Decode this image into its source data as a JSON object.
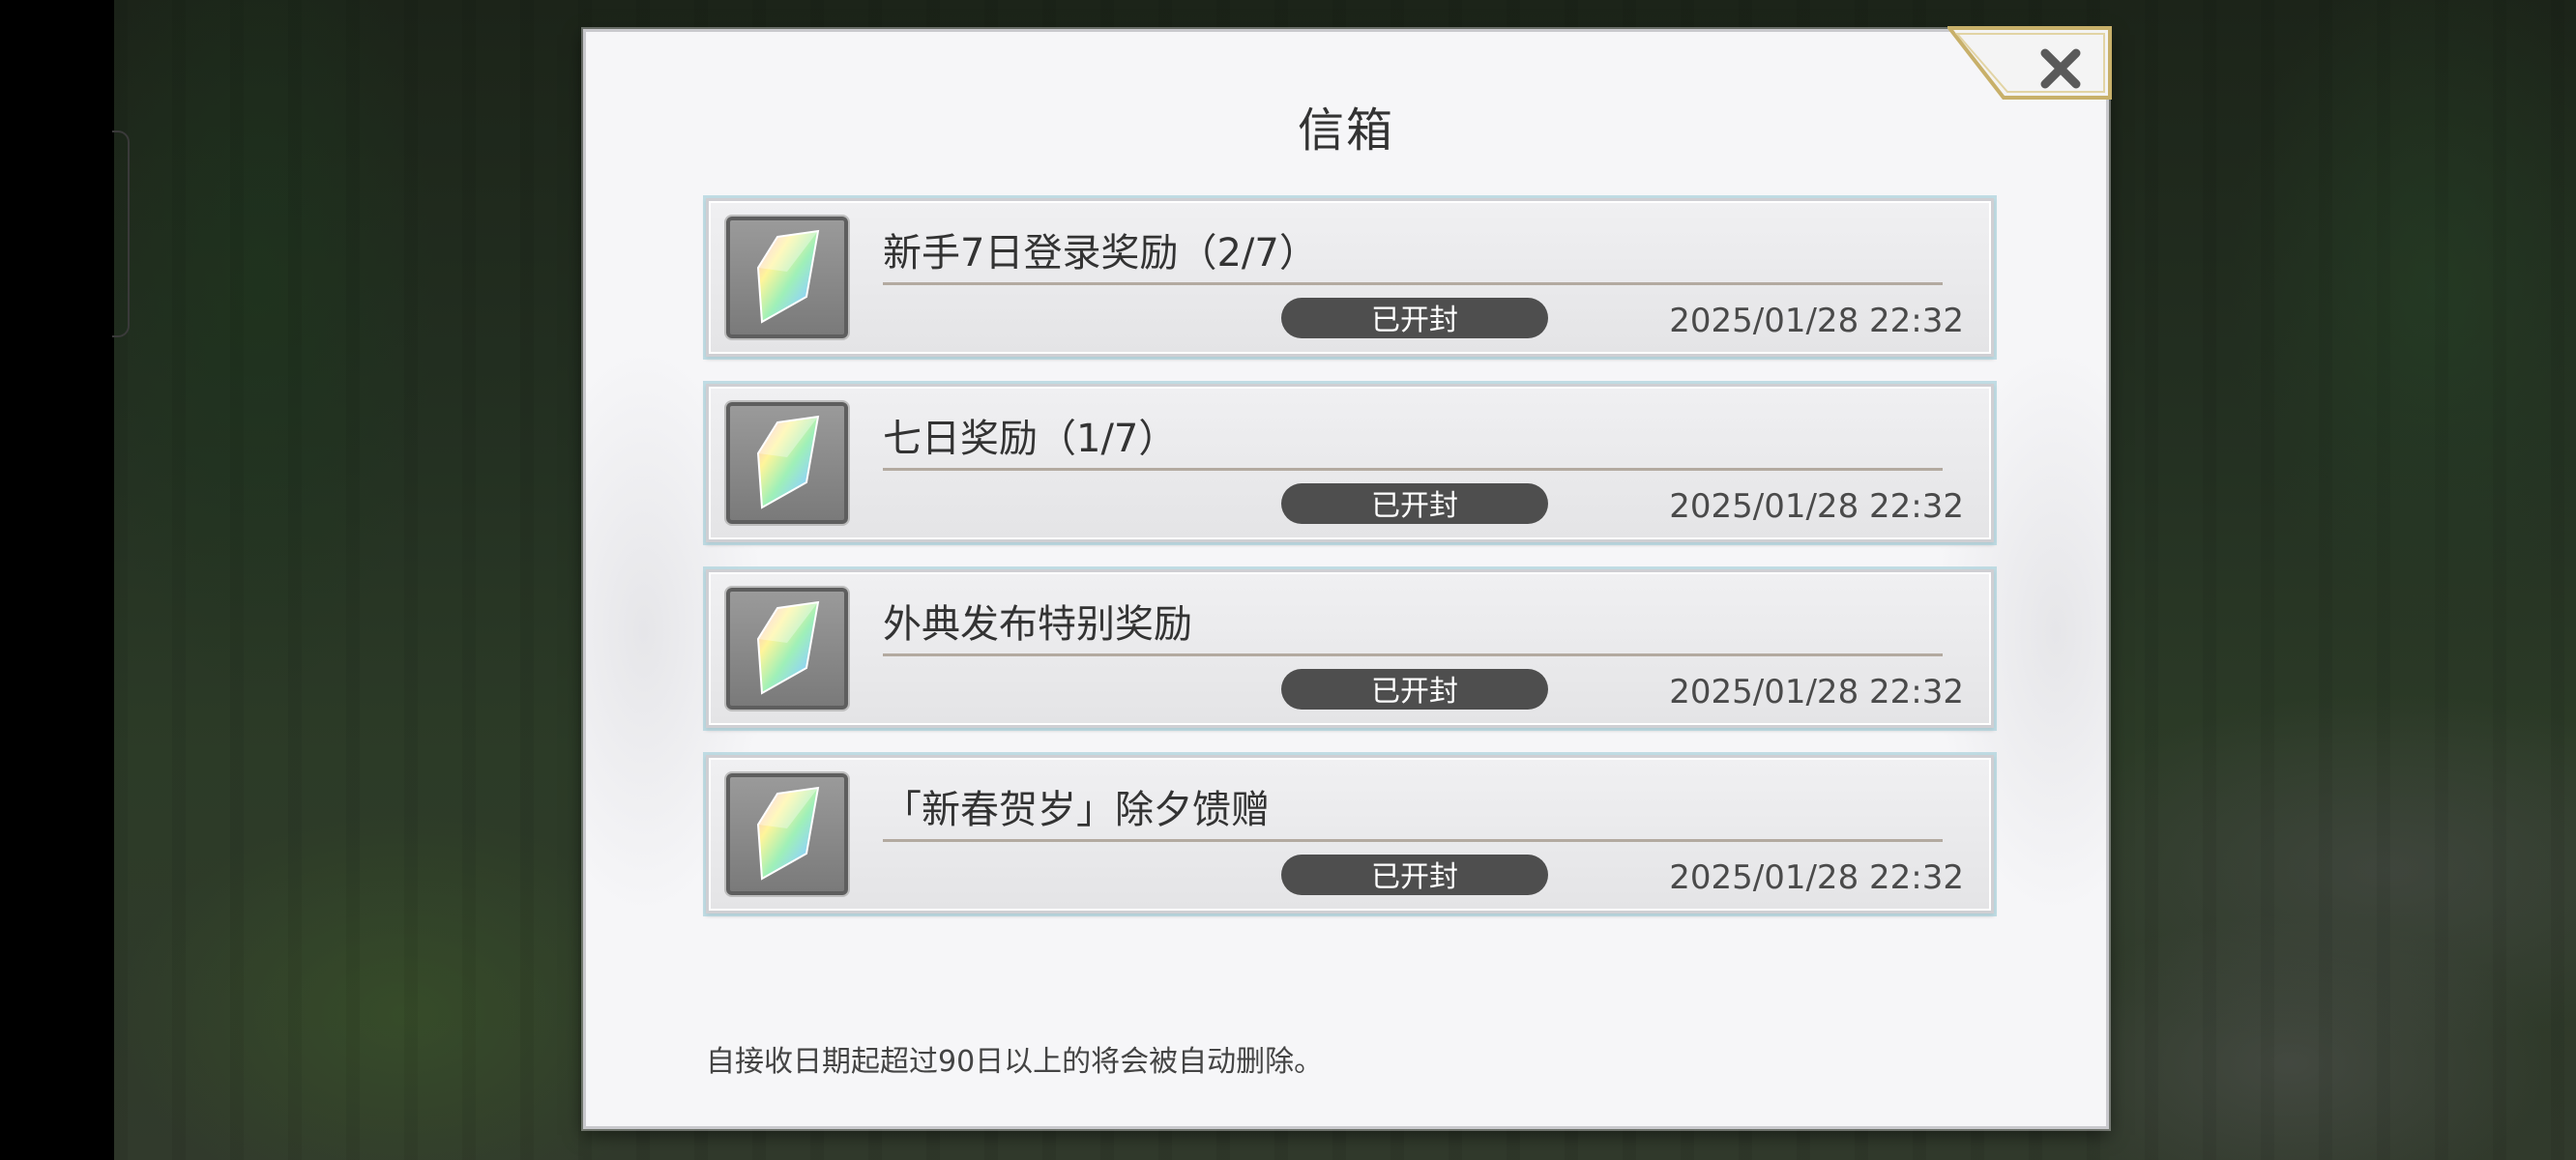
{
  "mailbox": {
    "title": "信箱",
    "close_icon": "close-x-icon",
    "items": [
      {
        "title": "新手7日登录奖励（2/7）",
        "status": "已开封",
        "date": "2025/01/28 22:32",
        "icon": "rainbow-crystal-icon"
      },
      {
        "title": "七日奖励（1/7）",
        "status": "已开封",
        "date": "2025/01/28 22:32",
        "icon": "rainbow-crystal-icon"
      },
      {
        "title": "外典发布特别奖励",
        "status": "已开封",
        "date": "2025/01/28 22:32",
        "icon": "rainbow-crystal-icon"
      },
      {
        "title": "「新春贺岁」除夕馈赠",
        "status": "已开封",
        "date": "2025/01/28 22:32",
        "icon": "rainbow-crystal-icon"
      }
    ],
    "footer_note": "自接收日期起超过90日以上的将会被自动删除。"
  },
  "colors": {
    "dialog_bg": "#f6f6f8",
    "badge_bg": "#4e4e4e",
    "close_frame_gold": "#c8b06a"
  }
}
